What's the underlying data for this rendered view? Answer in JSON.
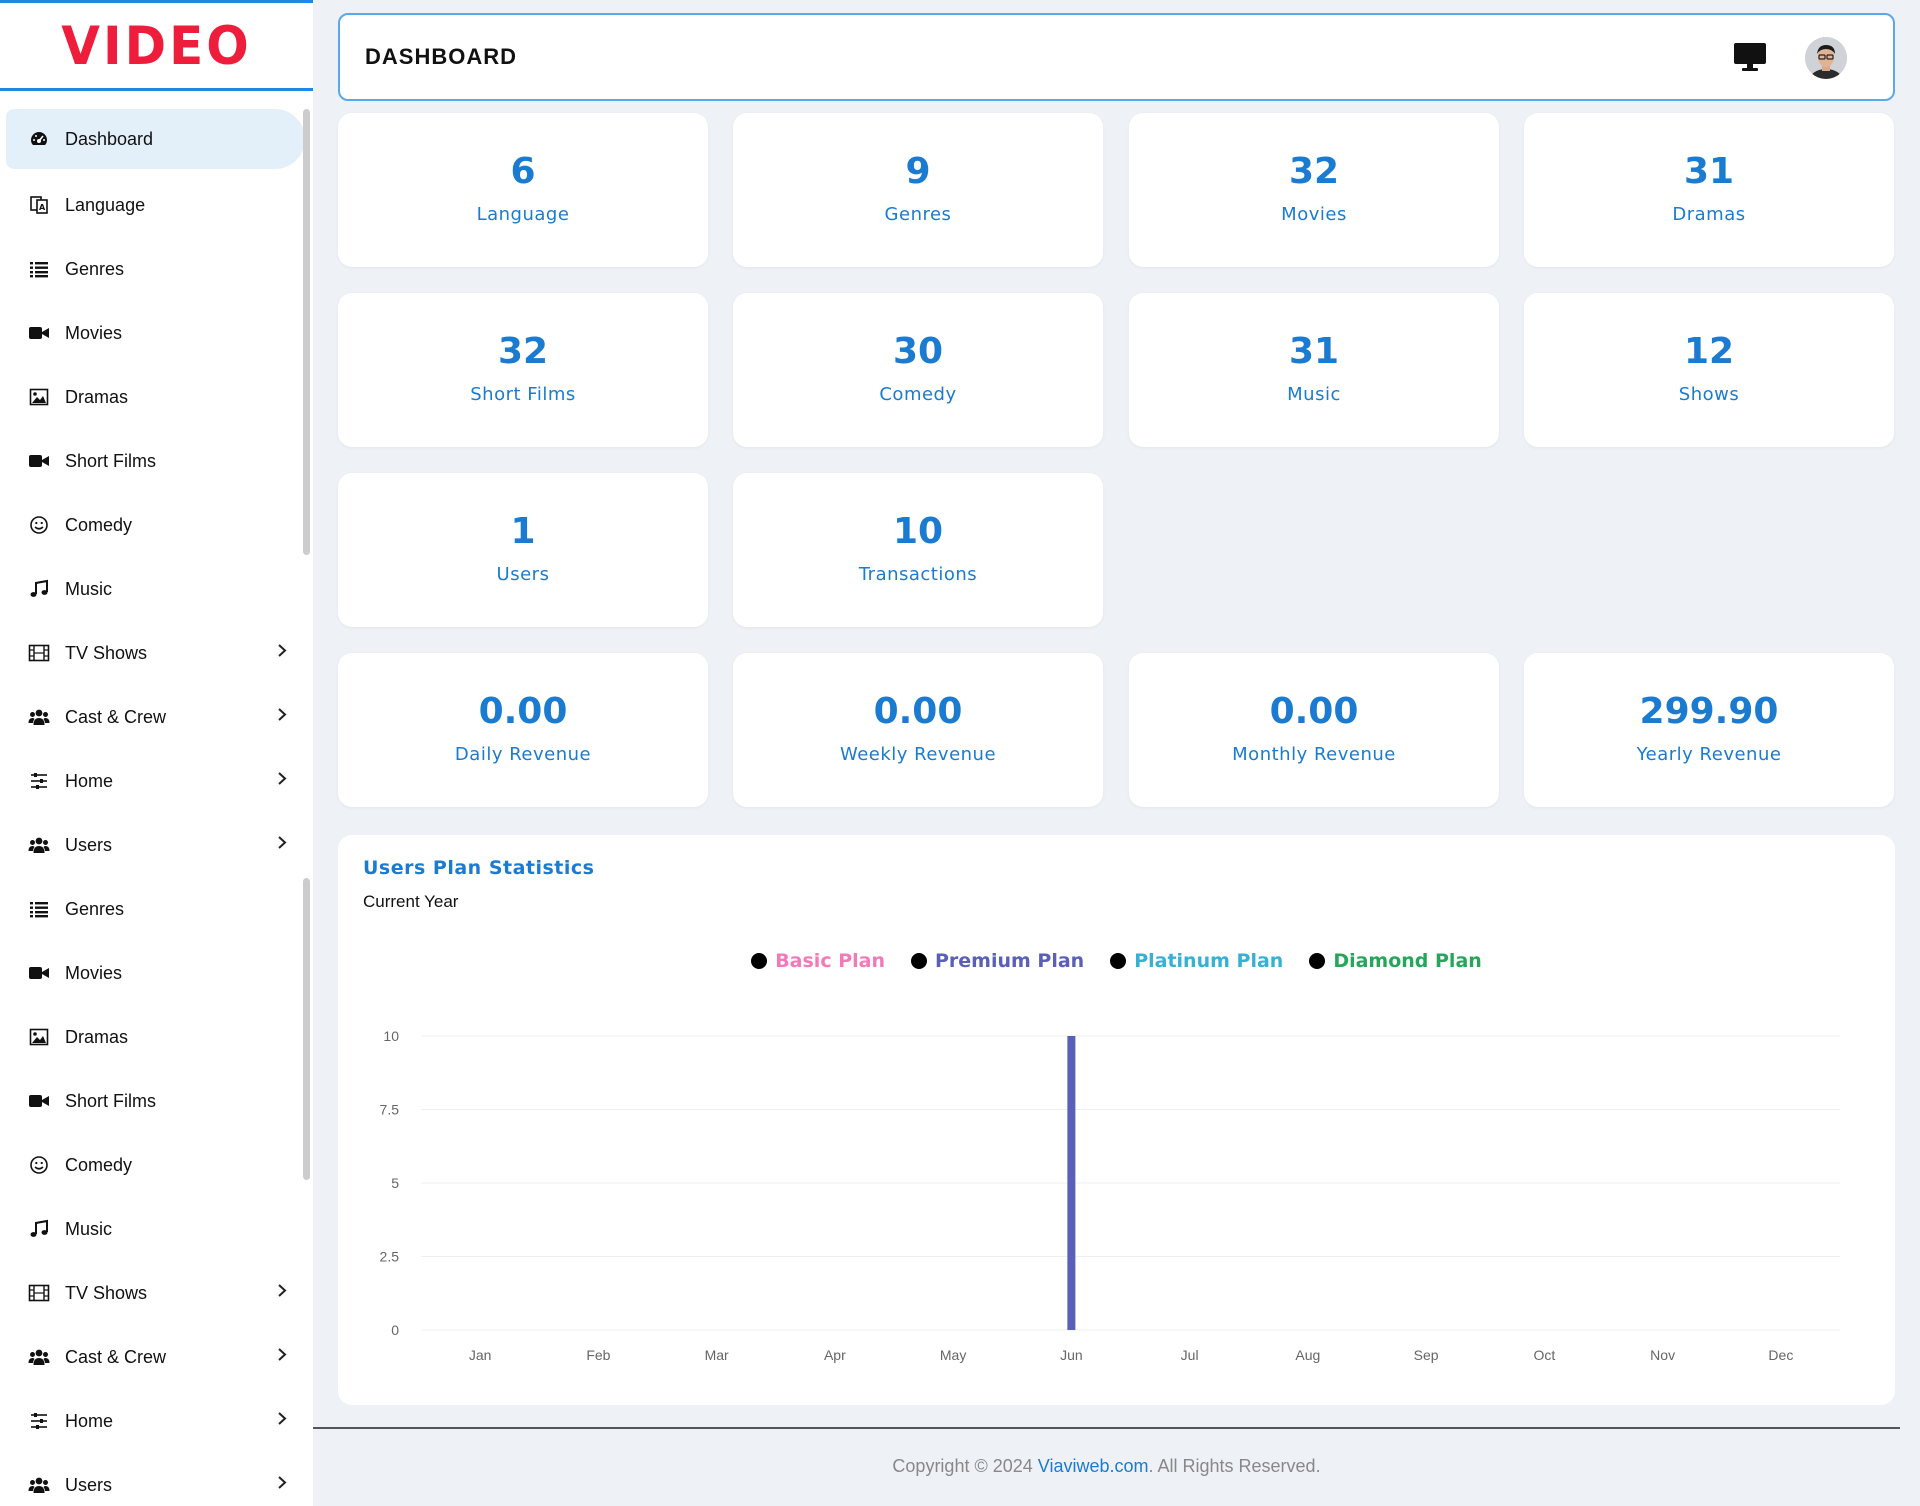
{
  "brand": {
    "logo_text": "VIDEO"
  },
  "sidebar": {
    "items": [
      {
        "label": "Dashboard",
        "icon": "dashboard-icon",
        "active": true,
        "has_submenu": false
      },
      {
        "label": "Language",
        "icon": "language-icon",
        "has_submenu": false
      },
      {
        "label": "Genres",
        "icon": "list-icon",
        "has_submenu": false
      },
      {
        "label": "Movies",
        "icon": "video-camera-icon",
        "has_submenu": false
      },
      {
        "label": "Dramas",
        "icon": "image-icon",
        "has_submenu": false
      },
      {
        "label": "Short Films",
        "icon": "video-camera-icon",
        "has_submenu": false
      },
      {
        "label": "Comedy",
        "icon": "smile-icon",
        "has_submenu": false
      },
      {
        "label": "Music",
        "icon": "music-icon",
        "has_submenu": false
      },
      {
        "label": "TV Shows",
        "icon": "film-icon",
        "has_submenu": true
      },
      {
        "label": "Cast & Crew",
        "icon": "users-icon",
        "has_submenu": true
      },
      {
        "label": "Home",
        "icon": "sliders-icon",
        "has_submenu": true
      },
      {
        "label": "Users",
        "icon": "users-icon",
        "has_submenu": true
      },
      {
        "label": "Genres",
        "icon": "list-icon",
        "has_submenu": false
      },
      {
        "label": "Movies",
        "icon": "video-camera-icon",
        "has_submenu": false
      },
      {
        "label": "Dramas",
        "icon": "image-icon",
        "has_submenu": false
      },
      {
        "label": "Short Films",
        "icon": "video-camera-icon",
        "has_submenu": false
      },
      {
        "label": "Comedy",
        "icon": "smile-icon",
        "has_submenu": false
      },
      {
        "label": "Music",
        "icon": "music-icon",
        "has_submenu": false
      },
      {
        "label": "TV Shows",
        "icon": "film-icon",
        "has_submenu": true
      },
      {
        "label": "Cast & Crew",
        "icon": "users-icon",
        "has_submenu": true
      },
      {
        "label": "Home",
        "icon": "sliders-icon",
        "has_submenu": true
      },
      {
        "label": "Users",
        "icon": "users-icon",
        "has_submenu": true
      }
    ]
  },
  "header": {
    "title": "DASHBOARD",
    "monitor_icon": "monitor-icon",
    "avatar_icon": "user-avatar"
  },
  "stats": [
    {
      "value": "6",
      "label": "Language"
    },
    {
      "value": "9",
      "label": "Genres"
    },
    {
      "value": "32",
      "label": "Movies"
    },
    {
      "value": "31",
      "label": "Dramas"
    },
    {
      "value": "32",
      "label": "Short Films"
    },
    {
      "value": "30",
      "label": "Comedy"
    },
    {
      "value": "31",
      "label": "Music"
    },
    {
      "value": "12",
      "label": "Shows"
    },
    {
      "value": "1",
      "label": "Users"
    },
    {
      "value": "10",
      "label": "Transactions"
    },
    {
      "value": "0.00",
      "label": "Daily Revenue"
    },
    {
      "value": "0.00",
      "label": "Weekly Revenue"
    },
    {
      "value": "0.00",
      "label": "Monthly Revenue"
    },
    {
      "value": "299.90",
      "label": "Yearly Revenue"
    }
  ],
  "chart_data": {
    "type": "bar",
    "title": "Users Plan Statistics",
    "subtitle": "Current Year",
    "categories": [
      "Jan",
      "Feb",
      "Mar",
      "Apr",
      "May",
      "Jun",
      "Jul",
      "Aug",
      "Sep",
      "Oct",
      "Nov",
      "Dec"
    ],
    "series": [
      {
        "name": "Basic Plan",
        "color": "#f27ab8",
        "values": [
          0,
          0,
          0,
          0,
          0,
          0,
          0,
          0,
          0,
          0,
          0,
          0
        ]
      },
      {
        "name": "Premium Plan",
        "color": "#5a5fb8",
        "values": [
          0,
          0,
          0,
          0,
          0,
          10,
          0,
          0,
          0,
          0,
          0,
          0
        ]
      },
      {
        "name": "Platinum Plan",
        "color": "#35b1d4",
        "values": [
          0,
          0,
          0,
          0,
          0,
          0,
          0,
          0,
          0,
          0,
          0,
          0
        ]
      },
      {
        "name": "Diamond Plan",
        "color": "#26a65b",
        "values": [
          0,
          0,
          0,
          0,
          0,
          0,
          0,
          0,
          0,
          0,
          0,
          0
        ]
      }
    ],
    "yticks": [
      "0",
      "2.5",
      "5",
      "7.5",
      "10"
    ],
    "ylim": [
      0,
      10
    ],
    "legend_position": "top-center",
    "grid": true
  },
  "footer": {
    "prefix": "Copyright © 2024 ",
    "link": "Viaviweb.com",
    "suffix": ". All Rights Reserved."
  }
}
